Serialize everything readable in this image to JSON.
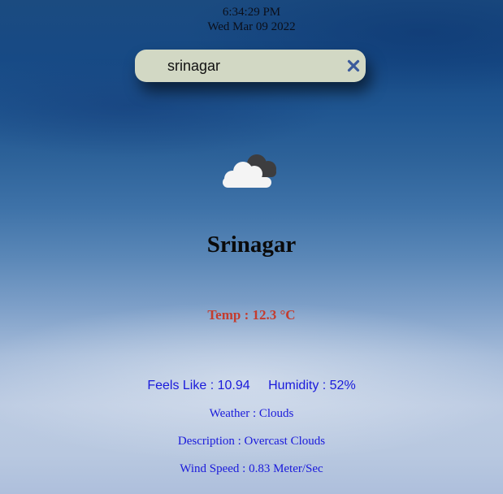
{
  "header": {
    "time": "6:34:29 PM",
    "date": "Wed Mar 09 2022"
  },
  "search": {
    "value": "srinagar",
    "clear_icon": "close-icon"
  },
  "weather": {
    "icon": "cloudy-icon",
    "city": "Srinagar",
    "temp": "Temp : 12.3 °C",
    "feels_like": "Feels Like : 10.94",
    "humidity": "Humidity : 52%",
    "condition": "Weather : Clouds",
    "description": "Description : Overcast Clouds",
    "wind_speed": "Wind Speed : 0.83 Meter/Sec"
  },
  "colors": {
    "accent_temp": "#c43c2e",
    "detail_text": "#1a1adb",
    "search_bg": "#d2d8c4",
    "clear_icon": "#3b5a9c"
  }
}
